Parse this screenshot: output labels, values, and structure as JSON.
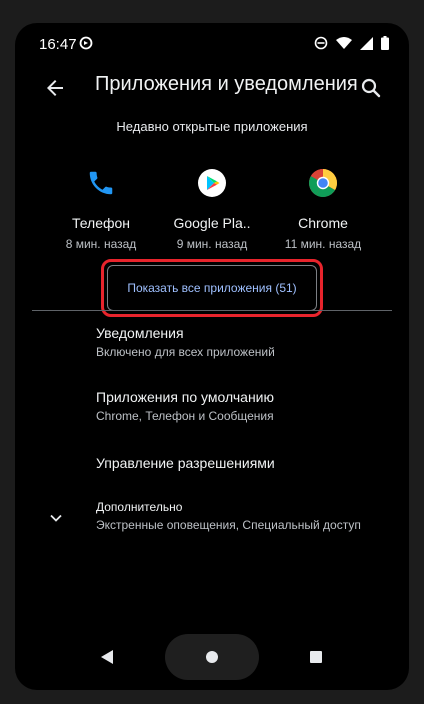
{
  "status_bar": {
    "time": "16:47",
    "icons": [
      "sync-icon",
      "dnd-icon",
      "wifi-icon",
      "signal-icon",
      "battery-icon"
    ]
  },
  "app_bar": {
    "title": "Приложения и уведомления",
    "back_icon": "arrow-back-icon",
    "search_icon": "search-icon"
  },
  "recent": {
    "header": "Недавно открытые приложения",
    "apps": [
      {
        "name": "Телефон",
        "time": "8 мин. назад",
        "icon": "phone-icon"
      },
      {
        "name": "Google Pla..",
        "time": "9 мин. назад",
        "icon": "google-play-icon"
      },
      {
        "name": "Chrome",
        "time": "11 мин. назад",
        "icon": "chrome-icon"
      }
    ]
  },
  "show_all": {
    "label": "Показать все приложения (51)"
  },
  "settings": [
    {
      "title": "Уведомления",
      "subtitle": "Включено для всех приложений"
    },
    {
      "title": "Приложения по умолчанию",
      "subtitle": "Chrome, Телефон и Сообщения"
    },
    {
      "title": "Управление разрешениями"
    },
    {
      "title": "Дополнительно",
      "subtitle": "Экстренные оповещения, Специальный доступ",
      "icon": "chevron-down-icon"
    }
  ],
  "colors": {
    "background": "#000000",
    "text_primary": "#f1f3f4",
    "text_secondary": "#bdc1c6",
    "accent": "#9fc0ff",
    "highlight": "#e8242c"
  }
}
